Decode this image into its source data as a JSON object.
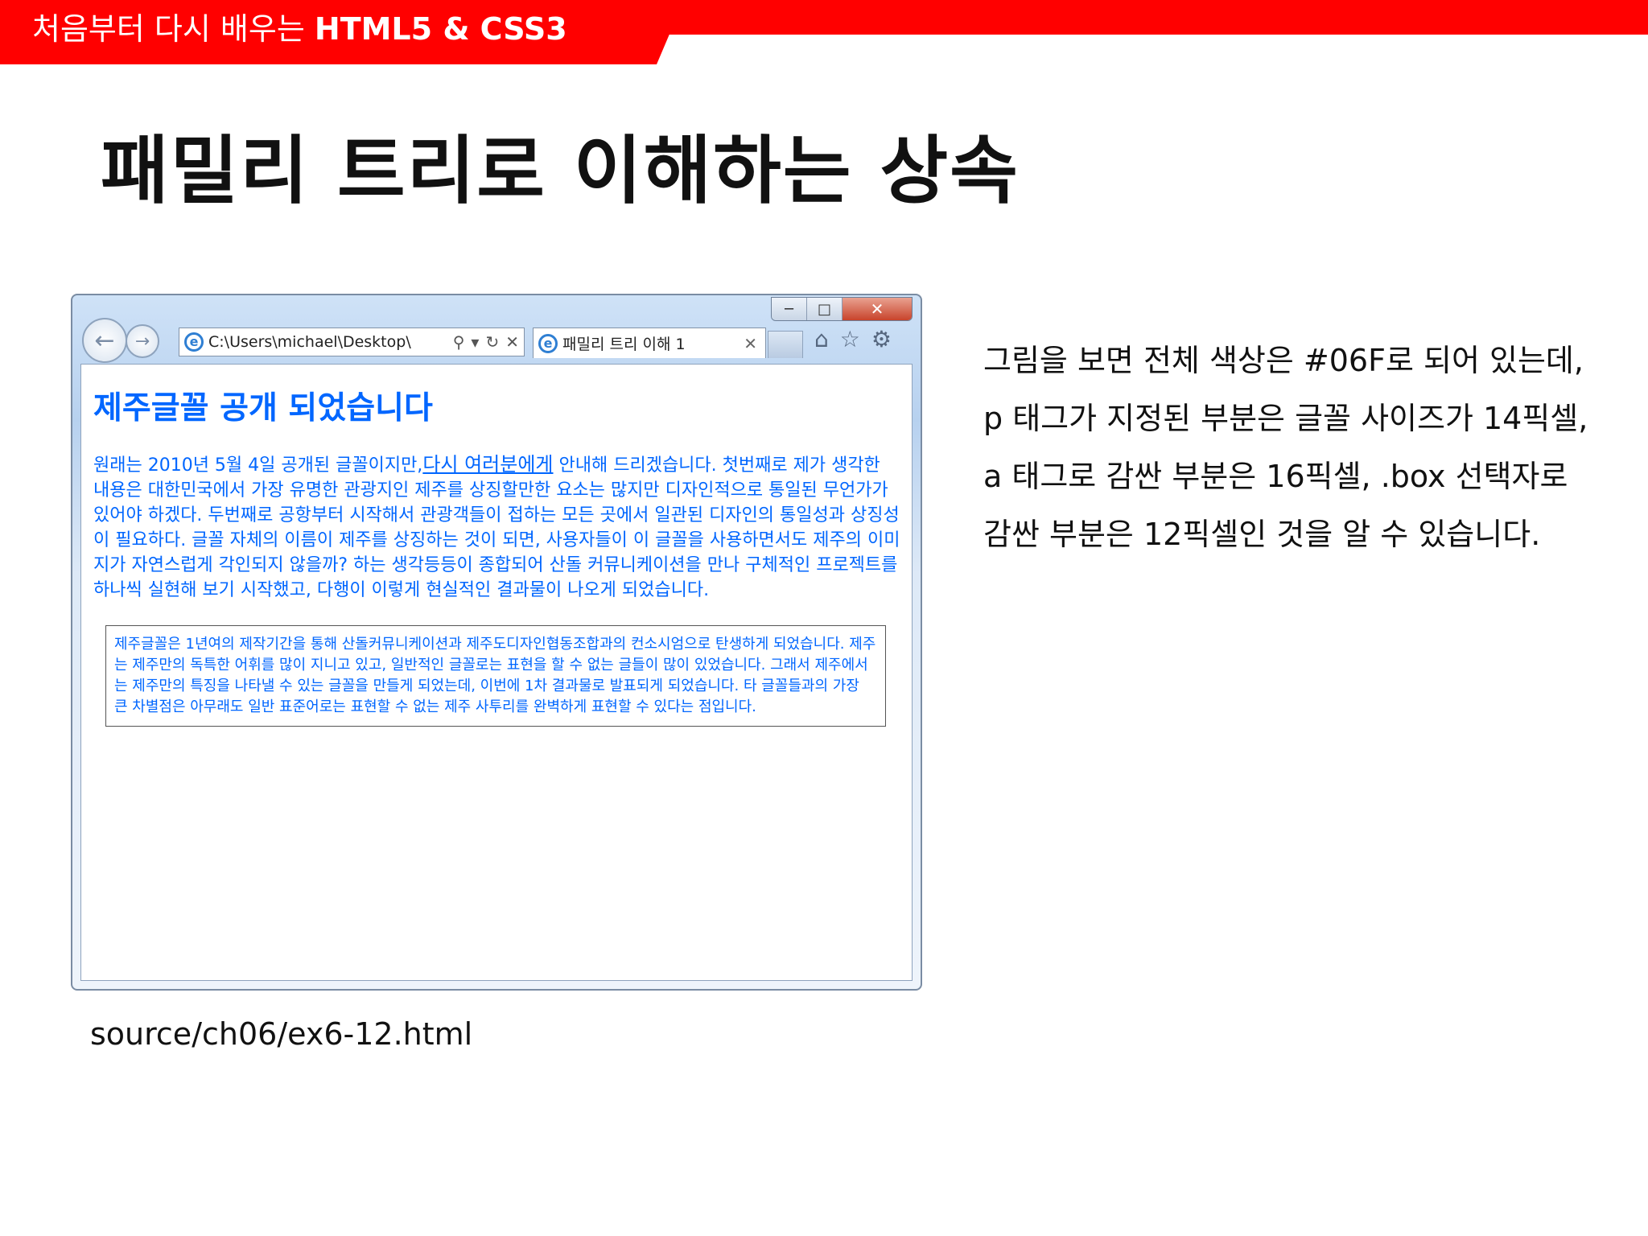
{
  "header": {
    "series_text": "처음부터 다시 배우는 ",
    "series_title": "HTML5 & CSS3",
    "band_color": "#ff0000"
  },
  "slide": {
    "title": "패밀리 트리로 이해하는 상속"
  },
  "browser": {
    "address": "C:\\Users\\michael\\Desktop\\",
    "tab_title": "패밀리 트리 이해 1",
    "window_controls": [
      "minimize-icon",
      "maximize-icon",
      "close-icon"
    ],
    "toolbar_icons": [
      "home-icon",
      "star-icon",
      "gear-icon"
    ],
    "page": {
      "heading": "제주글꼴 공개 되었습니다",
      "para_before": "원래는 2010년 5월 4일 공개된 글꼴이지만,",
      "para_link": "다시 여러분에게",
      "para_after": " 안내해 드리겠습니다. 첫번째로 제가 생각한 내용은 대한민국에서 가장 유명한 관광지인 제주를 상징할만한 요소는 많지만 디자인적으로 통일된 무언가가 있어야 하겠다. 두번째로 공항부터 시작해서 관광객들이 접하는 모든 곳에서 일관된 디자인의 통일성과 상징성이 필요하다. 글꼴 자체의 이름이 제주를 상징하는 것이 되면, 사용자들이 이 글꼴을 사용하면서도 제주의 이미지가 자연스럽게 각인되지 않을까? 하는 생각등등이 종합되어 산돌 커뮤니케이션을 만나 구체적인 프로젝트를 하나씩 실현해 보기 시작했고, 다행이 이렇게 현실적인 결과물이 나오게 되었습니다.",
      "box_text": "제주글꼴은 1년여의 제작기간을 통해 산돌커뮤니케이션과 제주도디자인협동조합과의 컨소시엄으로 탄생하게 되었습니다. 제주는 제주만의 독특한 어휘를 많이 지니고 있고, 일반적인 글꼴로는 표현을 할 수 없는 글들이 많이 있었습니다. 그래서 제주에서는 제주만의 특징을 나타낼 수 있는 글꼴을 만들게 되었는데, 이번에 1차 결과물로 발표되게 되었습니다. 타 글꼴들과의 가장 큰 차별점은 아무래도 일반 표준어로는 표현할 수 없는 제주 사투리를 완벽하게 표현할 수 있다는 점입니다.",
      "text_color": "#0066ff"
    }
  },
  "caption": {
    "source": "source/ch06/ex6-12.html"
  },
  "description": {
    "text": "그림을 보면 전체 색상은 #06F로 되어 있는데, p 태그가 지정된 부분은 글꼴 사이즈가 14픽셀, a 태그로 감싼 부분은 16픽셀, .box 선택자로 감싼 부분은 12픽셀인 것을 알 수 있습니다."
  }
}
